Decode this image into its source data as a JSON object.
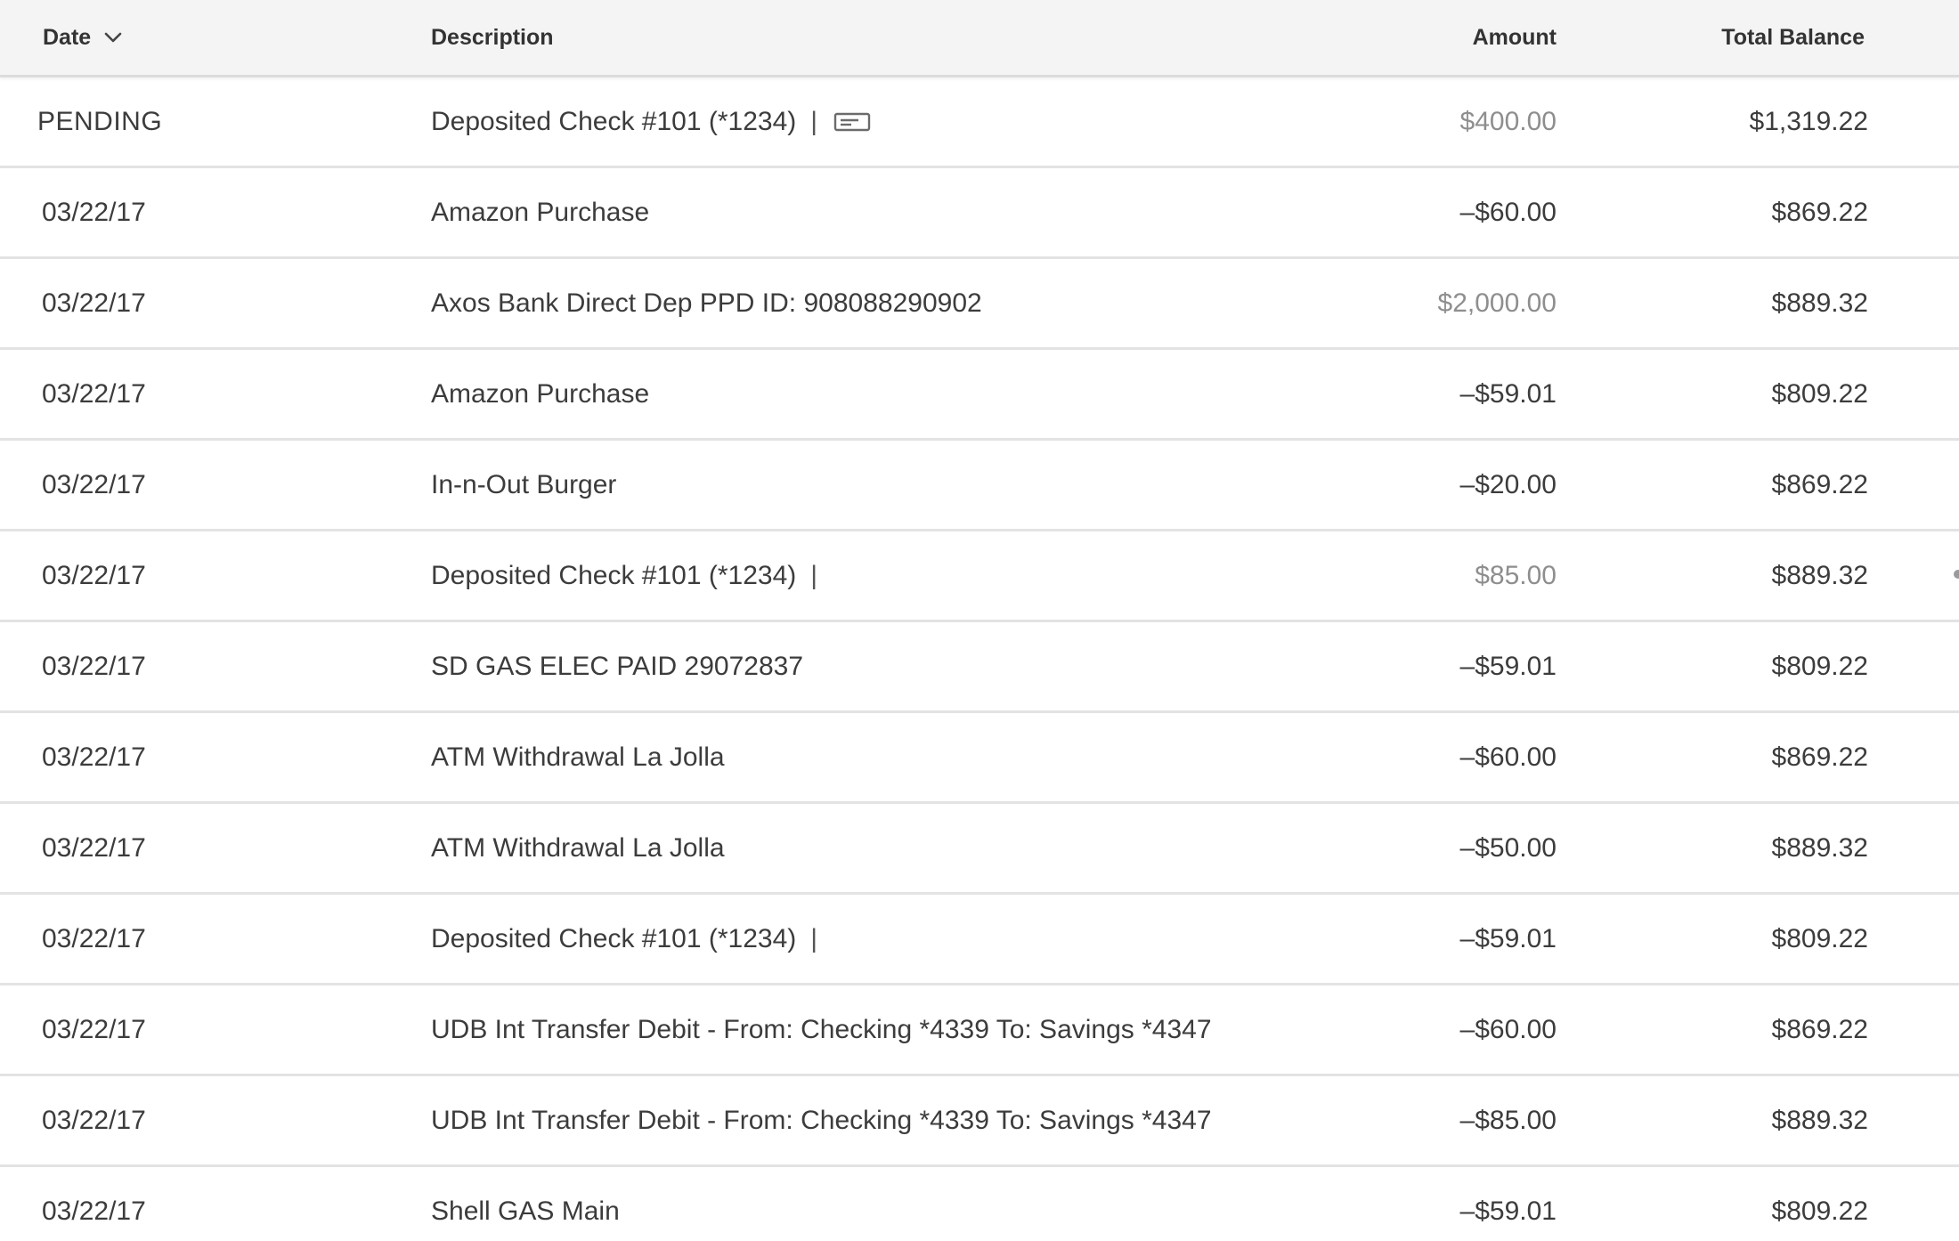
{
  "header": {
    "date_label": "Date",
    "description_label": "Description",
    "amount_label": "Amount",
    "balance_label": "Total Balance"
  },
  "rows": [
    {
      "date": "PENDING",
      "description": "Deposited Check #101 (*1234)",
      "pipe": "|",
      "has_check_icon": true,
      "amount": "$400.00",
      "type": "credit",
      "balance": "$1,319.22"
    },
    {
      "date": "03/22/17",
      "description": "Amazon Purchase",
      "pipe": "",
      "amount": "–$60.00",
      "type": "debit",
      "balance": "$869.22"
    },
    {
      "date": "03/22/17",
      "description": "Axos Bank Direct Dep PPD ID: 908088290902",
      "pipe": "",
      "amount": "$2,000.00",
      "type": "credit",
      "balance": "$889.32"
    },
    {
      "date": "03/22/17",
      "description": "Amazon Purchase",
      "pipe": "",
      "amount": "–$59.01",
      "type": "debit",
      "balance": "$809.22"
    },
    {
      "date": "03/22/17",
      "description": "In-n-Out Burger",
      "pipe": "",
      "amount": "–$20.00",
      "type": "debit",
      "balance": "$869.22"
    },
    {
      "date": "03/22/17",
      "description": "Deposited Check #101 (*1234)",
      "pipe": "|",
      "amount": "$85.00",
      "type": "credit",
      "balance": "$889.32"
    },
    {
      "date": "03/22/17",
      "description": "SD GAS ELEC PAID 29072837",
      "pipe": "",
      "amount": "–$59.01",
      "type": "debit",
      "balance": "$809.22"
    },
    {
      "date": "03/22/17",
      "description": "ATM Withdrawal La Jolla",
      "pipe": "",
      "amount": "–$60.00",
      "type": "debit",
      "balance": "$869.22"
    },
    {
      "date": "03/22/17",
      "description": "ATM Withdrawal La Jolla",
      "pipe": "",
      "amount": "–$50.00",
      "type": "debit",
      "balance": "$889.32"
    },
    {
      "date": "03/22/17",
      "description": "Deposited Check #101 (*1234)",
      "pipe": "|",
      "amount": "–$59.01",
      "type": "debit",
      "balance": "$809.22"
    },
    {
      "date": "03/22/17",
      "description": "UDB Int Transfer Debit - From: Checking *4339 To: Savings *4347",
      "pipe": "",
      "amount": "–$60.00",
      "type": "debit",
      "balance": "$869.22"
    },
    {
      "date": "03/22/17",
      "description": "UDB Int Transfer Debit - From: Checking *4339 To: Savings *4347",
      "pipe": "",
      "amount": "–$85.00",
      "type": "debit",
      "balance": "$889.32"
    },
    {
      "date": "03/22/17",
      "description": "Shell GAS Main",
      "pipe": "",
      "amount": "–$59.01",
      "type": "debit",
      "balance": "$809.22"
    }
  ],
  "icons": {
    "sort": "chevron-down-icon",
    "check_image": "check-image-icon"
  },
  "colors": {
    "header_bg": "#f4f4f4",
    "credit_text": "#8e8e8e",
    "debit_text": "#3c3c3c",
    "divider": "#e3e3e3"
  }
}
